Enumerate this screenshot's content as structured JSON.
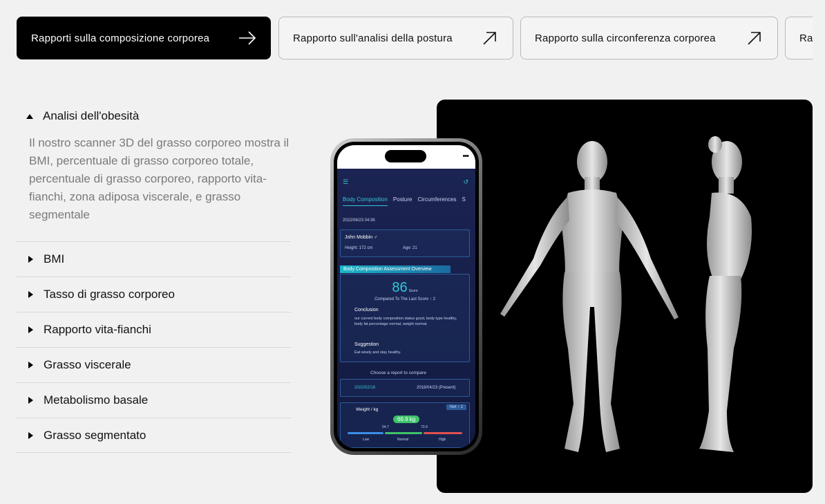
{
  "tabs": [
    {
      "label": "Rapporti sulla composizione corporea",
      "active": true,
      "icon": "arrow-right-icon"
    },
    {
      "label": "Rapporto sull'analisi della postura",
      "active": false,
      "icon": "arrow-up-right-icon"
    },
    {
      "label": "Rapporto sulla circonferenza corporea",
      "active": false,
      "icon": "arrow-up-right-icon"
    },
    {
      "label": "Ra",
      "active": false
    }
  ],
  "accordion": {
    "open_title": "Analisi dell'obesità",
    "open_description": "Il nostro scanner 3D del grasso corporeo mostra il BMI, percentuale di grasso corporeo totale, percentuale di grasso corporeo, rapporto vita-fianchi, zona adiposa viscerale, e grasso segmentale",
    "items": [
      "BMI",
      "Tasso di grasso corporeo",
      "Rapporto vita-fianchi",
      "Grasso viscerale",
      "Metabolismo basale",
      "Grasso segmentato"
    ]
  },
  "phone_app": {
    "tabs": [
      "Body Composition",
      "Posture",
      "Circumferences",
      "S"
    ],
    "date": "2022/06/23  04:36",
    "user_name": "John Mobbin ♂",
    "height": "Height:  172 cm",
    "age": "Age:  21",
    "overview_title": "Body Composition Assessment Overview",
    "score": "86",
    "score_label": "Score",
    "compare_text": "Compared To The Last Score ↑ 2",
    "conclusion_title": "Conclusion",
    "conclusion_text": "our current body composition status good, body type healthy, body fat percentage normal, weight normal.",
    "suggestion_title": "Suggestion",
    "suggestion_text": "Eat wisely and stay healthy.",
    "compare_title": "Choose a report to compare",
    "compare_from": "2022/02/16",
    "compare_to": "2018/04/23 (Present)",
    "weight_label": "Weight / kg",
    "net": "Net ↑ 2",
    "weight_value": "66.9 kg",
    "range_low_val": "54.7",
    "range_high_val": "73.9",
    "range_labels": [
      "Low",
      "Normal",
      "High"
    ]
  },
  "colors": {
    "accent": "#33c7d8",
    "active_tab_bg": "#000000",
    "hero_bg": "#000000"
  }
}
